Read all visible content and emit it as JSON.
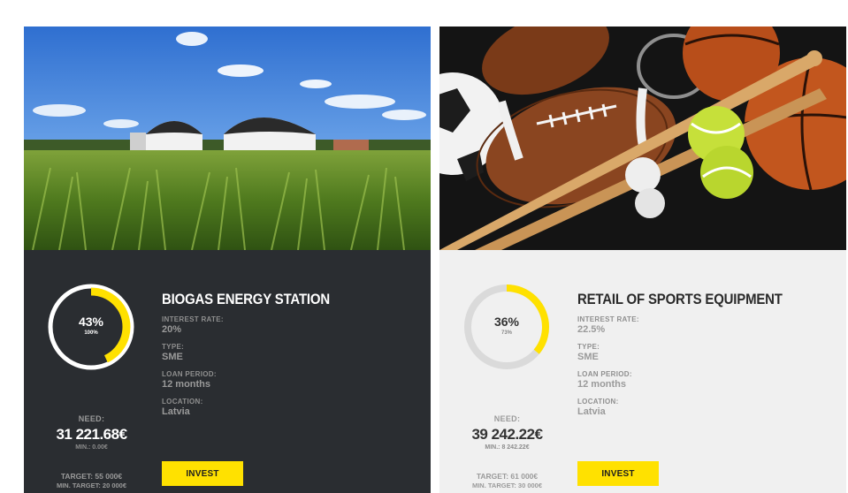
{
  "colors": {
    "accent": "#ffe100",
    "dark_panel": "#2a2d31",
    "light_panel": "#f0f0f0"
  },
  "projects": [
    {
      "image": "biogas-field-photo",
      "progress": {
        "label": "43%",
        "fraction": 0.43,
        "sub": "100%"
      },
      "need_label": "NEED:",
      "need_value": "31 221.68€",
      "min": "MIN.: 0.00€",
      "target": "TARGET: 55 000€",
      "min_target": "MIN. TARGET: 20 000€",
      "title": "BIOGAS ENERGY STATION",
      "fields": [
        {
          "label": "INTEREST RATE:",
          "value": "20%"
        },
        {
          "label": "TYPE:",
          "value": "SME"
        },
        {
          "label": "LOAN PERIOD:",
          "value": "12 months"
        },
        {
          "label": "LOCATION:",
          "value": "Latvia"
        }
      ],
      "invest_label": "INVEST"
    },
    {
      "image": "sports-balls-photo",
      "progress": {
        "label": "36%",
        "fraction": 0.36,
        "sub": "73%"
      },
      "need_label": "NEED:",
      "need_value": "39 242.22€",
      "min": "MIN.: 8 242.22€",
      "target": "TARGET: 61 000€",
      "min_target": "MIN. TARGET: 30 000€",
      "title": "RETAIL OF SPORTS EQUIPMENT",
      "fields": [
        {
          "label": "INTEREST RATE:",
          "value": "22.5%"
        },
        {
          "label": "TYPE:",
          "value": "SME"
        },
        {
          "label": "LOAN PERIOD:",
          "value": "12 months"
        },
        {
          "label": "LOCATION:",
          "value": "Latvia"
        }
      ],
      "invest_label": "INVEST"
    }
  ]
}
